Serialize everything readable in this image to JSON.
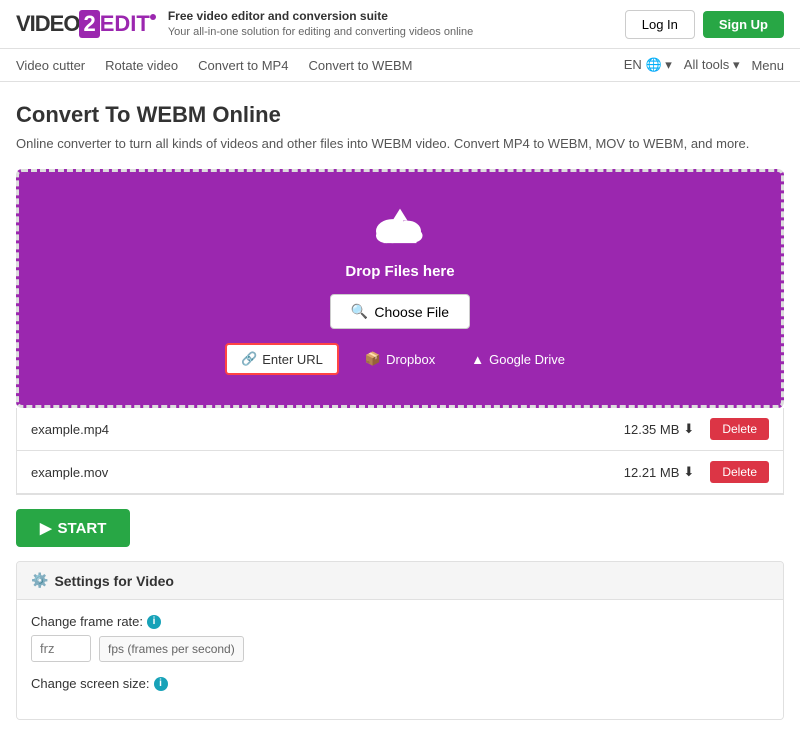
{
  "header": {
    "logo_video": "VIDEO",
    "logo_2": "2",
    "logo_edit": "EDIT",
    "logo_dot": "•",
    "tagline_title": "Free video editor and conversion suite",
    "tagline_sub": "Your all-in-one solution for editing and converting videos online",
    "login_label": "Log In",
    "signup_label": "Sign Up"
  },
  "nav": {
    "items": [
      {
        "label": "Video cutter"
      },
      {
        "label": "Rotate video"
      },
      {
        "label": "Convert to MP4"
      },
      {
        "label": "Convert to WEBM"
      }
    ],
    "right_lang": "EN",
    "right_tools": "All tools",
    "right_menu": "Menu"
  },
  "page": {
    "title": "Convert To WEBM Online",
    "description": "Online converter to turn all kinds of videos and other files into WEBM video. Convert MP4 to WEBM, MOV to WEBM, and more."
  },
  "upload": {
    "drop_text": "Drop Files here",
    "choose_label": "Choose File",
    "url_label": "Enter URL",
    "dropbox_label": "Dropbox",
    "gdrive_label": "Google Drive"
  },
  "files": [
    {
      "name": "example.mp4",
      "size": "12.35 MB"
    },
    {
      "name": "example.mov",
      "size": "12.21 MB"
    }
  ],
  "delete_label": "Delete",
  "start_label": "START",
  "settings": {
    "title": "Settings for Video",
    "frame_rate_label": "Change frame rate:",
    "frame_rate_placeholder": "frz",
    "frame_rate_hint": "fps (frames per second)",
    "screen_size_label": "Change screen size:"
  }
}
